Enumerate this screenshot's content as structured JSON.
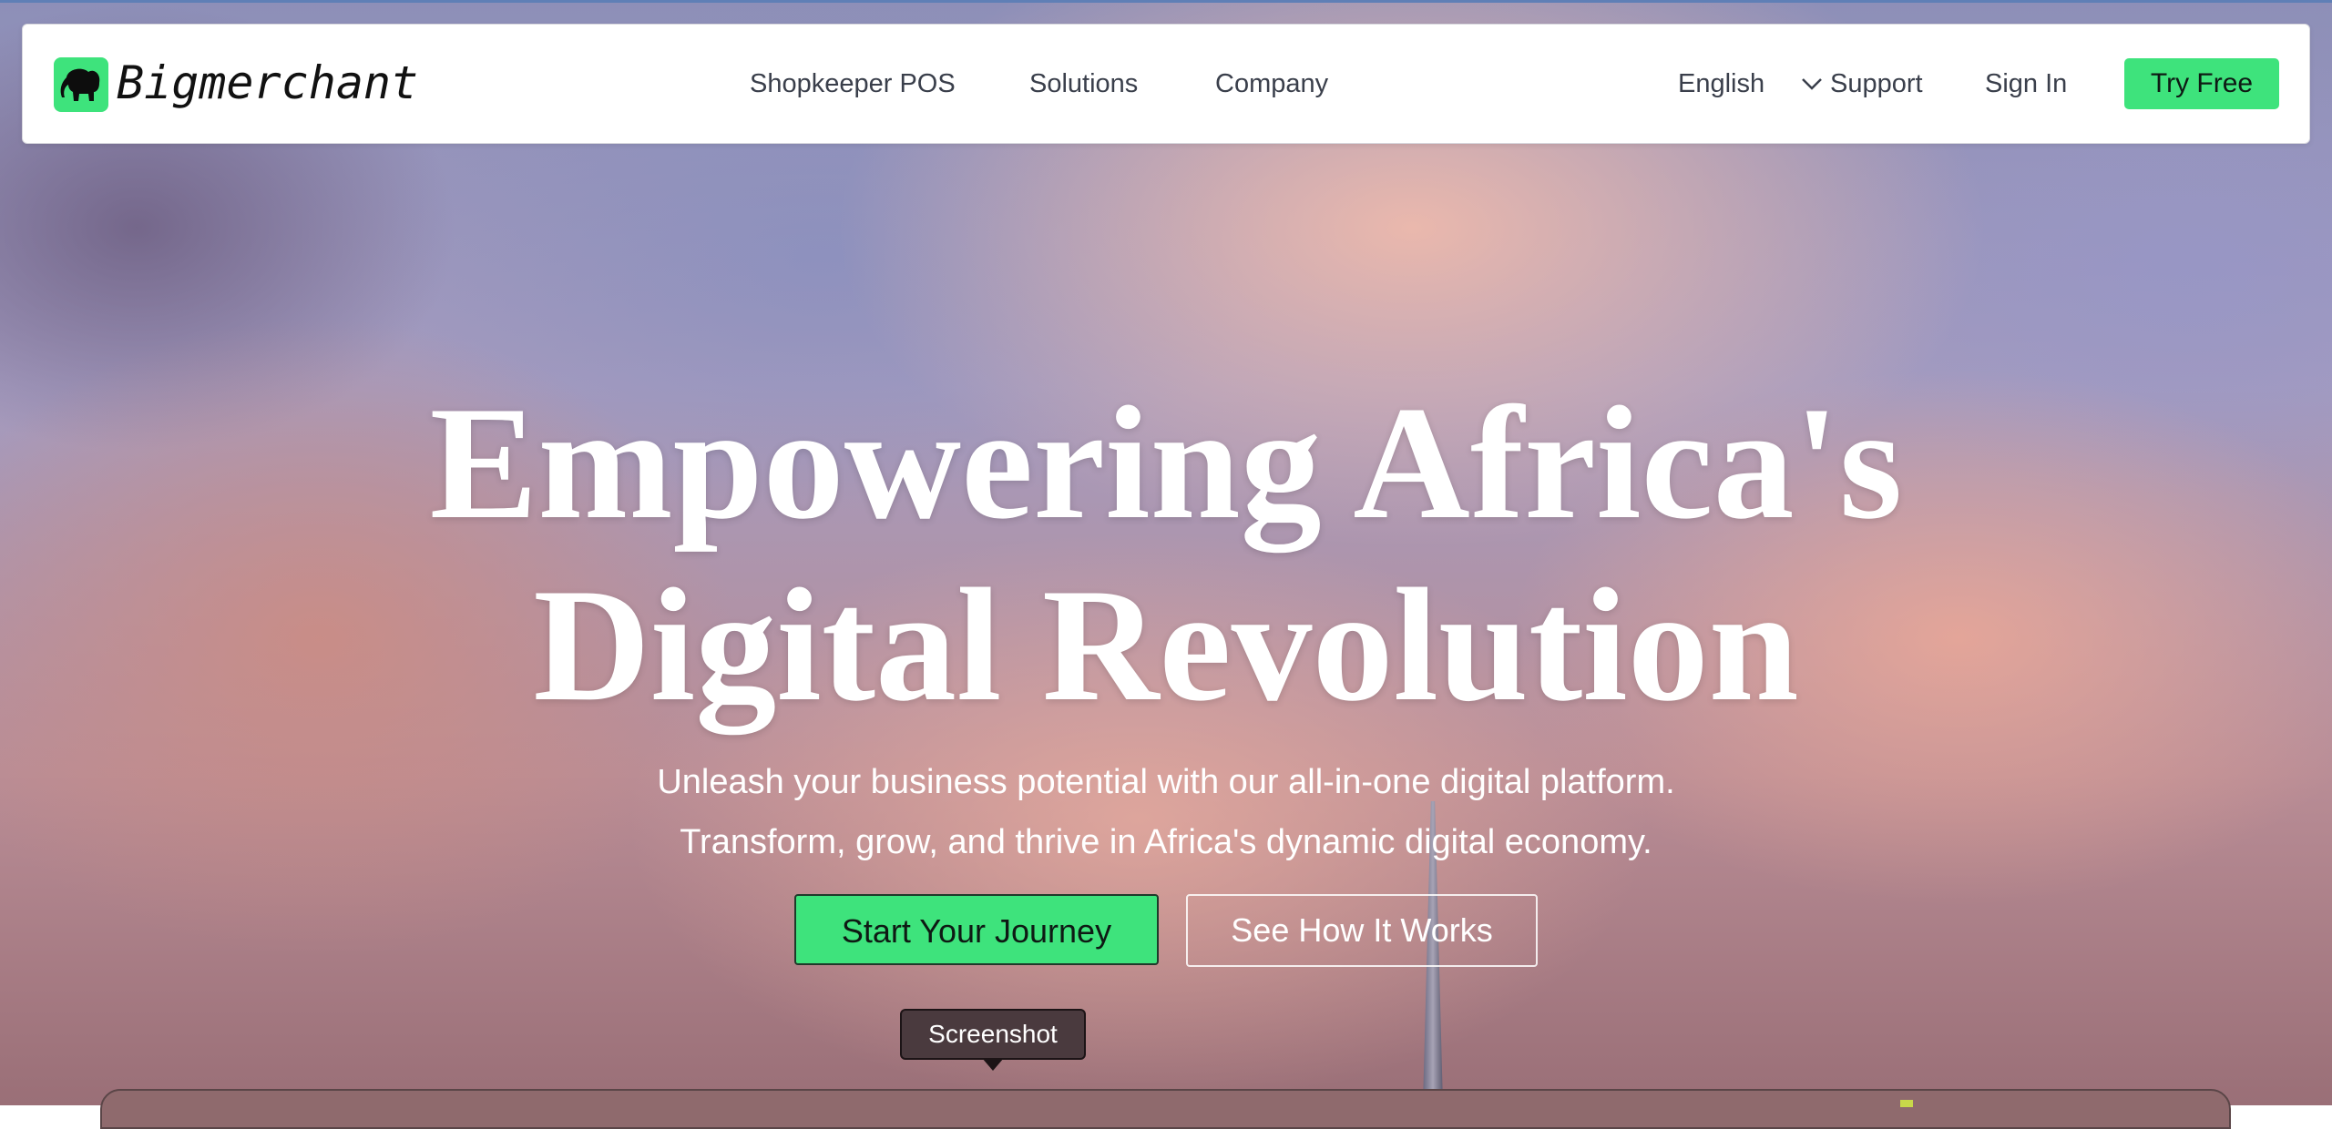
{
  "brand": {
    "name": "Bigmerchant",
    "logo_icon": "elephant-icon",
    "accent_color": "#3ee37c"
  },
  "nav": {
    "links": [
      "Shopkeeper POS",
      "Solutions",
      "Company"
    ],
    "language": "English",
    "support": "Support",
    "sign_in": "Sign In",
    "try_free": "Try Free"
  },
  "hero": {
    "headline_line1": "Empowering Africa's",
    "headline_line2": "Digital Revolution",
    "subtitle_line1": "Unleash your business potential with our all-in-one digital platform.",
    "subtitle_line2": "Transform, grow, and thrive in Africa's dynamic digital economy.",
    "cta_primary": "Start Your Journey",
    "cta_secondary": "See How It Works"
  },
  "tooltip": {
    "label": "Screenshot"
  }
}
